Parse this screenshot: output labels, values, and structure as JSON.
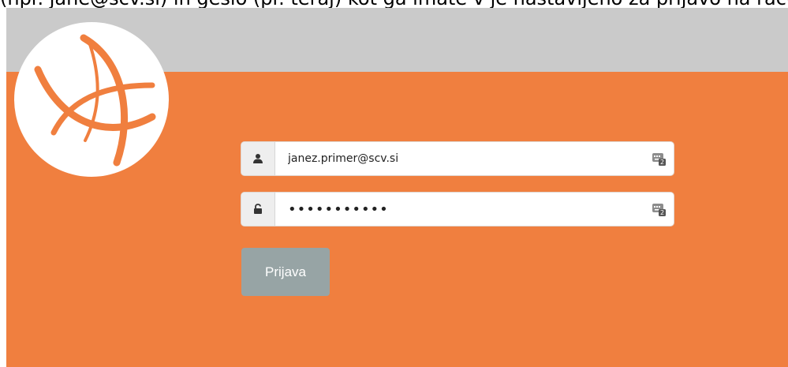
{
  "top_caption": "(npr. jane@scv.si) in geslo (pr. teraj) kot ga imate v je nastavljeno za prijavo na računalnik.",
  "logo": {
    "icon": "scv-swirl-logo-icon",
    "color": "#f07f3f"
  },
  "username": {
    "icon": "user-icon",
    "value": "janez.primer@scv.si",
    "keyboard_icon": "keyboard-icon"
  },
  "password": {
    "icon": "unlock-icon",
    "value": "•••••••••••",
    "keyboard_icon": "keyboard-icon"
  },
  "login_button": {
    "label": "Prijava",
    "color": "#97a4a5"
  },
  "colors": {
    "header_band": "#cacaca",
    "panel": "#f07f3f"
  }
}
